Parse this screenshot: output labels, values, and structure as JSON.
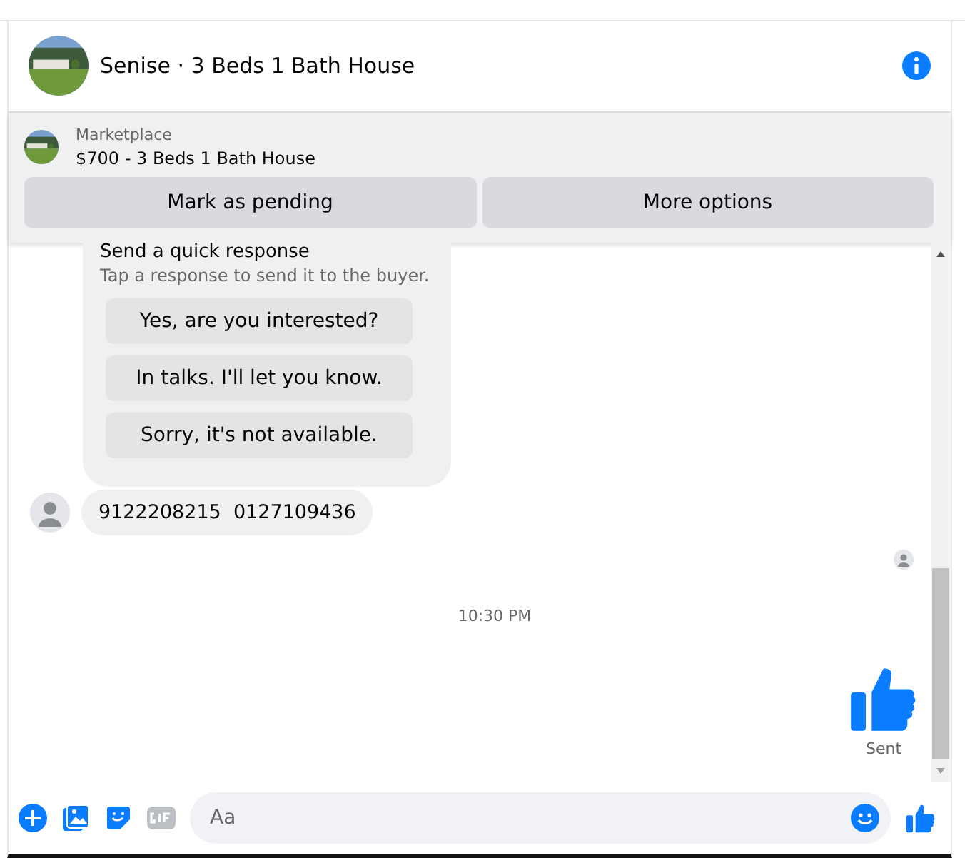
{
  "header": {
    "title": "Senise · 3 Beds 1 Bath House"
  },
  "listing": {
    "source": "Marketplace",
    "title": "$700 - 3 Beds 1 Bath House",
    "buttons": [
      "Mark as pending",
      "More options"
    ]
  },
  "quick_response": {
    "title": "Send a quick response",
    "subtitle": "Tap a response to send it to the buyer.",
    "options": [
      "Yes, are you interested?",
      "In talks. I'll let you know.",
      "Sorry, it's not available."
    ]
  },
  "messages": [
    {
      "text": "9122208215  0127109436"
    }
  ],
  "timestamp": "10:30 PM",
  "sent": {
    "status": "Sent"
  },
  "composer": {
    "placeholder": "Aa"
  }
}
